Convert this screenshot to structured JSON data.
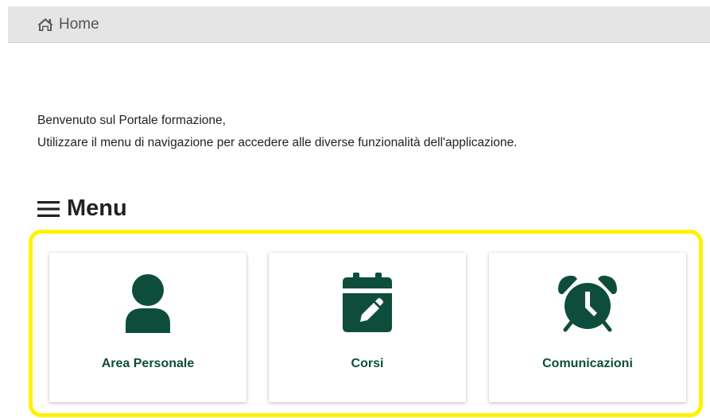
{
  "breadcrumb": {
    "home_label": "Home",
    "icon": "home-icon"
  },
  "welcome": {
    "line1": "Benvenuto sul Portale formazione,",
    "line2": "Utilizzare il menu di navigazione per accedere alle diverse funzionalità dell'applicazione."
  },
  "menu": {
    "title": "Menu",
    "icon": "hamburger-icon",
    "items": [
      {
        "label": "Area Personale",
        "icon": "user-icon"
      },
      {
        "label": "Corsi",
        "icon": "calendar-edit-icon"
      },
      {
        "label": "Comunicazioni",
        "icon": "alarm-clock-icon"
      }
    ]
  },
  "colors": {
    "accent": "#0e4d3c",
    "highlight": "#fff200",
    "breadcrumb_bg": "#e5e5e5"
  }
}
